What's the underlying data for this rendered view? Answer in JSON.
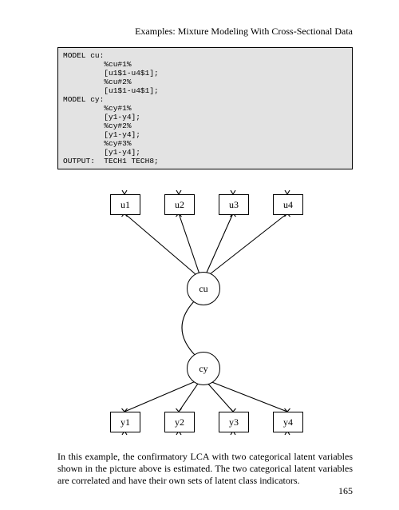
{
  "header": "Examples: Mixture Modeling With Cross-Sectional Data",
  "code_block": "MODEL cu:\n         %cu#1%\n         [u1$1-u4$1];\n         %cu#2%\n         [u1$1-u4$1];\nMODEL cy:\n         %cy#1%\n         [y1-y4];\n         %cy#2%\n         [y1-y4];\n         %cy#3%\n         [y1-y4];\nOUTPUT:  TECH1 TECH8;",
  "nodes": {
    "u1": "u1",
    "u2": "u2",
    "u3": "u3",
    "u4": "u4",
    "cu": "cu",
    "cy": "cy",
    "y1": "y1",
    "y2": "y2",
    "y3": "y3",
    "y4": "y4"
  },
  "body_text": "In this example, the confirmatory LCA with two categorical latent variables shown in the picture above is estimated.  The two categorical latent variables are correlated and have their own sets of latent class indicators.",
  "page_number": "165"
}
